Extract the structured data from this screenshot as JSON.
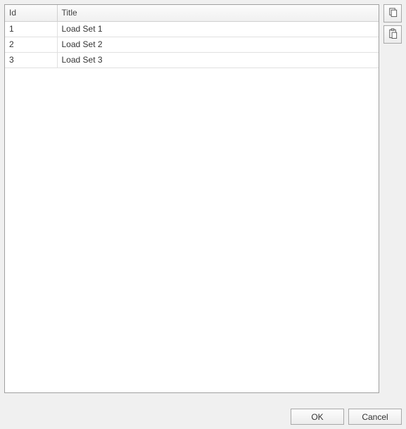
{
  "table": {
    "headers": {
      "id": "Id",
      "title": "Title"
    },
    "rows": [
      {
        "id": "1",
        "title": "Load Set 1"
      },
      {
        "id": "2",
        "title": "Load Set 2"
      },
      {
        "id": "3",
        "title": "Load Set 3"
      }
    ]
  },
  "side_icons": {
    "copy": "copy-icon",
    "paste": "paste-icon"
  },
  "buttons": {
    "ok": "OK",
    "cancel": "Cancel"
  }
}
